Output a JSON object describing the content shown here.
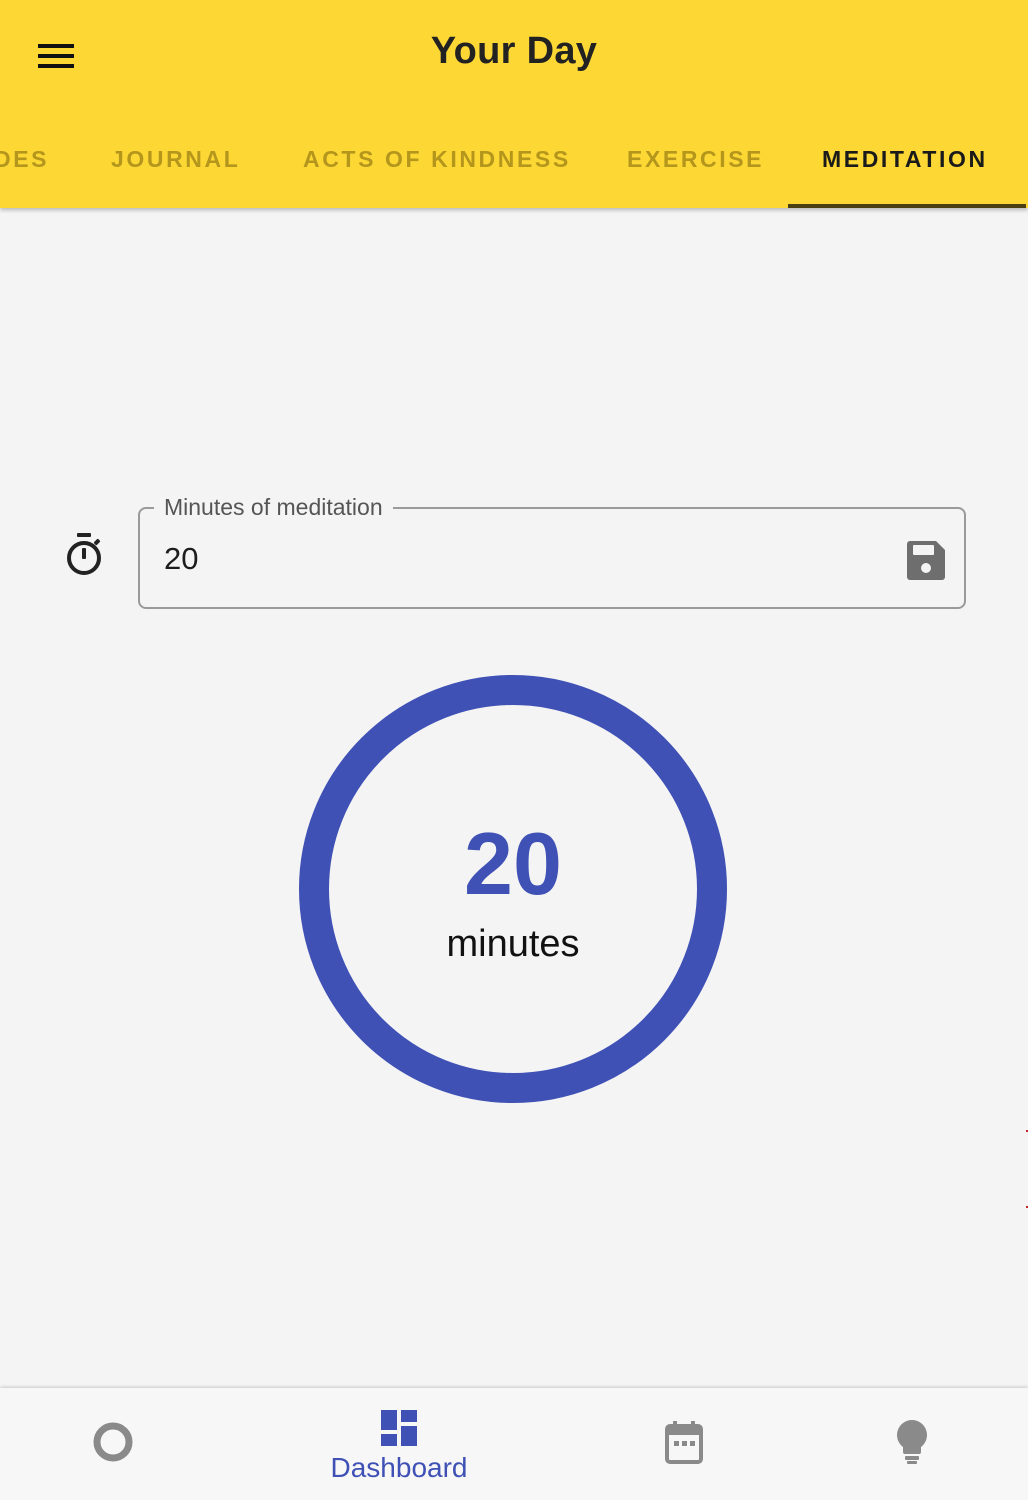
{
  "header": {
    "title": "Your Day",
    "menu_icon": "menu-icon"
  },
  "tabs": [
    {
      "label": "DES",
      "active": false
    },
    {
      "label": "JOURNAL",
      "active": false
    },
    {
      "label": "ACTS OF KINDNESS",
      "active": false
    },
    {
      "label": "EXERCISE",
      "active": false
    },
    {
      "label": "MEDITATION",
      "active": true
    }
  ],
  "meditation": {
    "field_label": "Minutes of meditation",
    "field_value": "20",
    "leading_icon": "timer-icon",
    "trailing_icon": "save-icon",
    "progress": {
      "value": "20",
      "unit": "minutes",
      "fraction": 1.0
    }
  },
  "bottom_nav": [
    {
      "label": "",
      "icon": "circle-outline-icon",
      "active": false
    },
    {
      "label": "Dashboard",
      "icon": "dashboard-icon",
      "active": true
    },
    {
      "label": "",
      "icon": "calendar-icon",
      "active": false
    },
    {
      "label": "",
      "icon": "lightbulb-icon",
      "active": false
    }
  ],
  "colors": {
    "appbar": "#fdd835",
    "accent": "#3f51b5",
    "background": "#f4f4f4",
    "tab_inactive": "#a08a1e",
    "nav_inactive": "#8a8a8a"
  }
}
